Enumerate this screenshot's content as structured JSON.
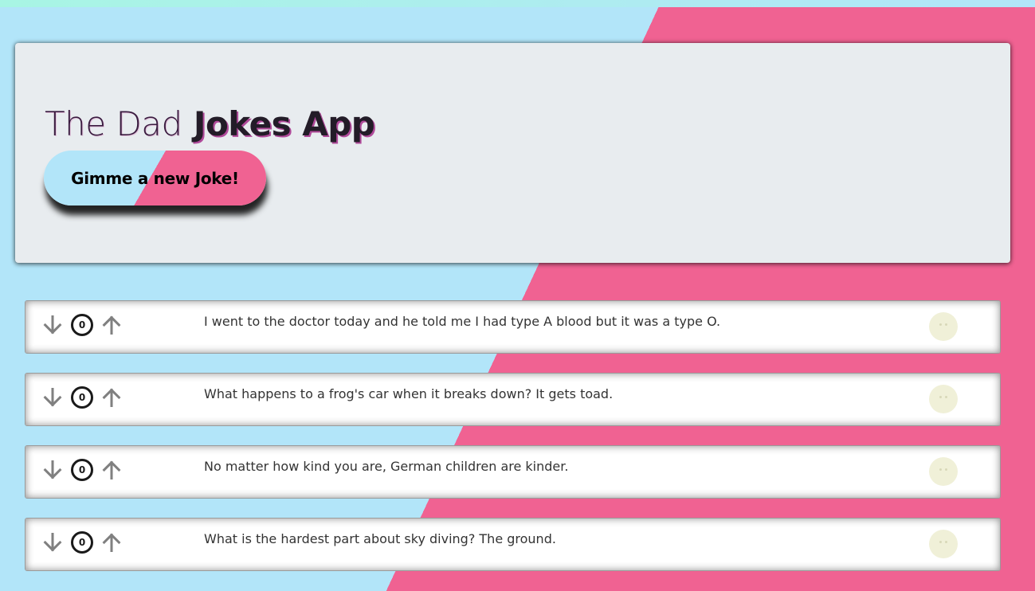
{
  "header": {
    "title_light": "The Dad",
    "title_bold": "Jokes App",
    "new_joke_button": "Gimme a new Joke!"
  },
  "jokes": [
    {
      "score": "0",
      "text": "I went to the doctor today and he told me I had type A blood but it was a type O.",
      "emoji": "neutral-face-icon"
    },
    {
      "score": "0",
      "text": "What happens to a frog's car when it breaks down? It gets toad.",
      "emoji": "neutral-face-icon"
    },
    {
      "score": "0",
      "text": "No matter how kind you are, German children are kinder.",
      "emoji": "neutral-face-icon"
    },
    {
      "score": "0",
      "text": "What is the hardest part about sky diving? The ground.",
      "emoji": "neutral-face-icon"
    }
  ],
  "icons": {
    "downvote": "arrow-down-icon",
    "upvote": "arrow-up-icon"
  },
  "colors": {
    "background_blue": "#b2e5f9",
    "background_pink": "#f06292",
    "panel": "#e8ecef",
    "arrow": "#808080"
  }
}
